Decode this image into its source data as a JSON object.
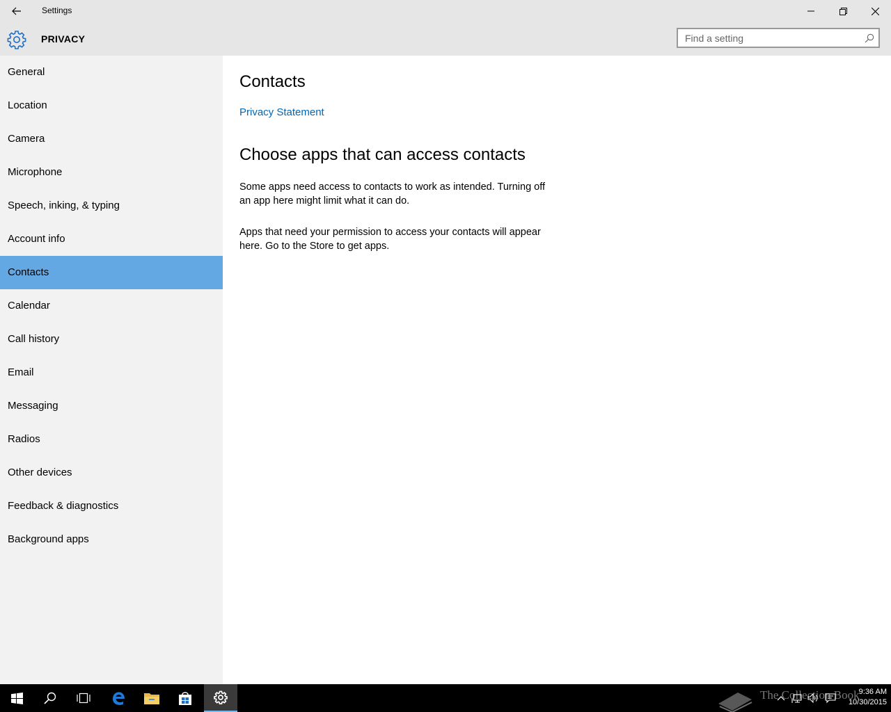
{
  "window": {
    "title": "Settings"
  },
  "header": {
    "section_title": "PRIVACY",
    "search_placeholder": "Find a setting",
    "search_value": ""
  },
  "sidebar": {
    "items": [
      {
        "label": "General"
      },
      {
        "label": "Location"
      },
      {
        "label": "Camera"
      },
      {
        "label": "Microphone"
      },
      {
        "label": "Speech, inking, & typing"
      },
      {
        "label": "Account info"
      },
      {
        "label": "Contacts"
      },
      {
        "label": "Calendar"
      },
      {
        "label": "Call history"
      },
      {
        "label": "Email"
      },
      {
        "label": "Messaging"
      },
      {
        "label": "Radios"
      },
      {
        "label": "Other devices"
      },
      {
        "label": "Feedback & diagnostics"
      },
      {
        "label": "Background apps"
      }
    ],
    "selected": "Contacts"
  },
  "main": {
    "title": "Contacts",
    "privacy_link": "Privacy Statement",
    "subheading": "Choose apps that can access contacts",
    "paragraph1": "Some apps need access to contacts to work as intended. Turning off an app here might limit what it can do.",
    "paragraph2": "Apps that need your permission to access your contacts will appear here. Go to the Store to get apps."
  },
  "taskbar": {
    "time": "9:36 AM",
    "date": "10/30/2015",
    "watermark": "The Collection Book"
  },
  "colors": {
    "selected_item": "#64a8e3",
    "link": "#0067b8",
    "accent": "#1e6ec8",
    "titlebar": "#e6e6e6",
    "sidebar": "#f2f2f2"
  },
  "icons": [
    "back-arrow-icon",
    "minimize-icon",
    "restore-icon",
    "close-icon",
    "gear-icon",
    "search-icon",
    "windows-start-icon",
    "taskbar-search-icon",
    "task-view-icon",
    "edge-icon",
    "file-explorer-icon",
    "store-icon",
    "settings-icon",
    "book-icon",
    "chevron-up-icon",
    "network-icon",
    "volume-icon",
    "action-center-icon"
  ]
}
